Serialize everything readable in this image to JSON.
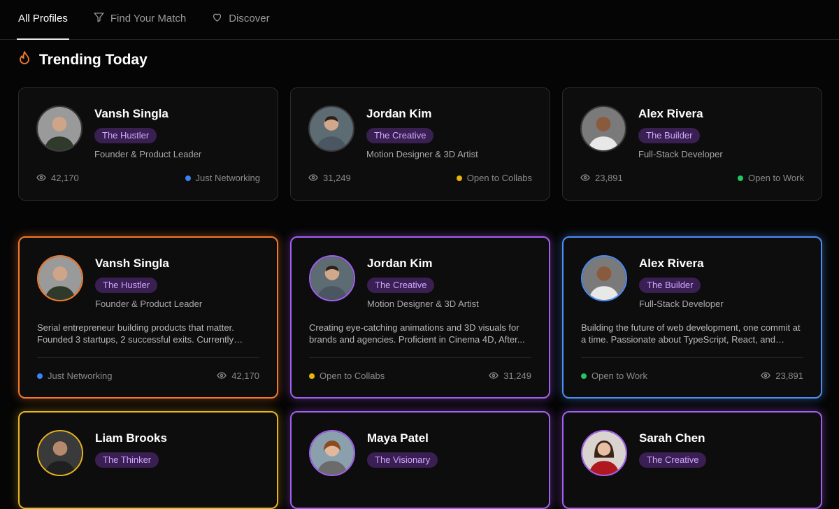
{
  "nav": {
    "tabs": [
      {
        "label": "All Profiles",
        "icon": "none"
      },
      {
        "label": "Find Your Match",
        "icon": "filter-icon"
      },
      {
        "label": "Discover",
        "icon": "heart-icon"
      }
    ]
  },
  "trending": {
    "title": "Trending Today",
    "icon": "flame-icon",
    "cards": [
      {
        "name": "Vansh Singla",
        "badge": "The Hustler",
        "role": "Founder & Product Leader",
        "views": "42,170",
        "status": "Just Networking",
        "status_color": "#3b82f6"
      },
      {
        "name": "Jordan Kim",
        "badge": "The Creative",
        "role": "Motion Designer & 3D Artist",
        "views": "31,249",
        "status": "Open to Collabs",
        "status_color": "#eab308"
      },
      {
        "name": "Alex Rivera",
        "badge": "The Builder",
        "role": "Full-Stack Developer",
        "views": "23,891",
        "status": "Open to Work",
        "status_color": "#22c55e"
      }
    ]
  },
  "profiles": [
    {
      "name": "Vansh Singla",
      "badge": "The Hustler",
      "role": "Founder & Product Leader",
      "description": "Serial entrepreneur building products that matter. Founded 3 startups, 2 successful exits. Currently building...",
      "status": "Just Networking",
      "status_color": "#3b82f6",
      "views": "42,170",
      "accent": "#f27a2c"
    },
    {
      "name": "Jordan Kim",
      "badge": "The Creative",
      "role": "Motion Designer & 3D Artist",
      "description": "Creating eye-catching animations and 3D visuals for brands and agencies. Proficient in Cinema 4D, After...",
      "status": "Open to Collabs",
      "status_color": "#eab308",
      "views": "31,249",
      "accent": "#a35ff0"
    },
    {
      "name": "Alex Rivera",
      "badge": "The Builder",
      "role": "Full-Stack Developer",
      "description": "Building the future of web development, one commit at a time. Passionate about TypeScript, React, and Node.js...",
      "status": "Open to Work",
      "status_color": "#22c55e",
      "views": "23,891",
      "accent": "#4d8df5"
    },
    {
      "name": "Liam Brooks",
      "badge": "The Thinker",
      "accent": "#e8b41f"
    },
    {
      "name": "Maya Patel",
      "badge": "The Visionary",
      "accent": "#a35ff0"
    },
    {
      "name": "Sarah Chen",
      "badge": "The Creative",
      "accent": "#a35ff0"
    }
  ]
}
